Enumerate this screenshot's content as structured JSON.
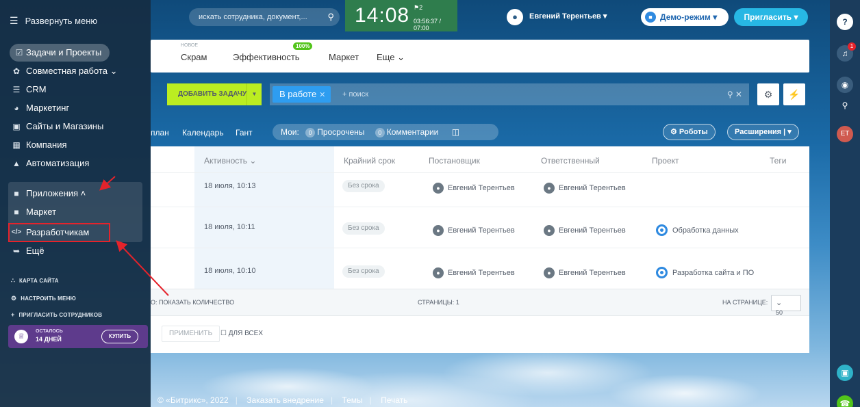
{
  "header": {
    "search_placeholder": "искать сотрудника, документ,...",
    "clock_time": "14:08",
    "clock_flag": "2",
    "clock_worktime": "03:56:37 / 07:00",
    "user_name": "Евгений Терентьев",
    "demo_label": "Демо-режим",
    "invite_label": "Пригласить"
  },
  "tabs": {
    "new_label": "НОВОЕ",
    "scrum": "Скрам",
    "efficiency": "Эффективность",
    "efficiency_badge": "100%",
    "market": "Маркет",
    "more": "Еще"
  },
  "toolbar": {
    "add_task": "ДОБАВИТЬ ЗАДАЧУ",
    "filter_chip": "В работе",
    "filter_placeholder": "+ поиск"
  },
  "views": {
    "plan": "план",
    "calendar": "Календарь",
    "gantt": "Гант",
    "mine_label": "Мои:",
    "overdue_count": "0",
    "overdue_label": "Просрочены",
    "comments_count": "0",
    "comments_label": "Комментарии",
    "robots": "Роботы",
    "extensions": "Расширения"
  },
  "grid": {
    "columns": [
      "Активность",
      "Крайний срок",
      "Постановщик",
      "Ответственный",
      "Проект",
      "Теги"
    ],
    "rows": [
      {
        "activity": "18 июля, 10:13",
        "deadline": "Без срока",
        "creator": "Евгений Терентьев",
        "responsible": "Евгений Терентьев",
        "project": ""
      },
      {
        "activity": "18 июля, 10:11",
        "deadline": "Без срока",
        "creator": "Евгений Терентьев",
        "responsible": "Евгений Терентьев",
        "project": "Обработка данных"
      },
      {
        "activity": "18 июля, 10:10",
        "deadline": "Без срока",
        "creator": "Евгений Терентьев",
        "responsible": "Евгений Терентьев",
        "project": "Разработка сайта и ПО"
      }
    ],
    "show_count": "О: ПОКАЗАТЬ КОЛИЧЕСТВО",
    "pages": "СТРАНИЦЫ: 1",
    "per_page_label": "НА СТРАНИЦЕ:",
    "per_page_value": "50",
    "apply": "ПРИМЕНИТЬ",
    "for_all": "ДЛЯ ВСЕХ"
  },
  "footer": {
    "copyright": "© «Битрикс», 2022",
    "order": "Заказать внедрение",
    "themes": "Темы",
    "print": "Печать"
  },
  "menu": {
    "toggle": "Развернуть меню",
    "items": [
      {
        "label": "Задачи и Проекты"
      },
      {
        "label": "Совместная работа"
      },
      {
        "label": "CRM"
      },
      {
        "label": "Маркетинг"
      },
      {
        "label": "Сайты и Магазины"
      },
      {
        "label": "Компания"
      },
      {
        "label": "Автоматизация"
      },
      {
        "label": "Приложения"
      },
      {
        "label": "Маркет"
      },
      {
        "label": "Разработчикам"
      },
      {
        "label": "Ещё"
      }
    ],
    "sitemap": "КАРТА САЙТА",
    "configure": "НАСТРОИТЬ МЕНЮ",
    "invite_staff": "ПРИГЛАСИТЬ СОТРУДНИКОВ",
    "trial_left": "ОСТАЛОСЬ",
    "trial_days": "14 ДНЕЙ",
    "buy": "КУПИТЬ"
  },
  "rail": {
    "user_initials": "ЕТ",
    "notification_count": "1"
  },
  "colors": {
    "accent": "#27b7e4",
    "add_task": "#bbed21",
    "annotation": "#e5232b",
    "trial": "#5e3b8c"
  }
}
